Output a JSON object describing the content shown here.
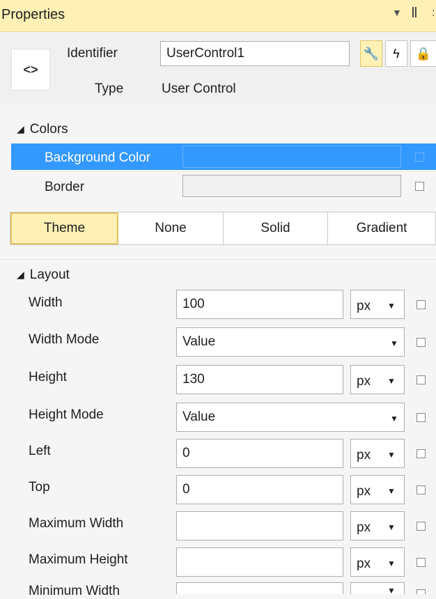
{
  "panel": {
    "title": "Properties",
    "dropdown_icon": "triangle-down-icon",
    "pin_icon": "pin-icon"
  },
  "header": {
    "code_button_glyph": "<>",
    "identifier_label": "Identifier",
    "identifier_value": "UserControl1",
    "type_label": "Type",
    "type_value": "User Control",
    "toolbar": [
      {
        "name": "properties-wrench-button",
        "glyph": "🔧",
        "icon": "wrench-icon",
        "active": true
      },
      {
        "name": "events-lightning-button",
        "glyph": "ϟ",
        "icon": "lightning-icon",
        "active": false
      },
      {
        "name": "lock-button",
        "glyph": "🔒",
        "icon": "lock-icon",
        "active": false
      }
    ]
  },
  "colors": {
    "section_label": "Colors",
    "background_color_label": "Background Color",
    "border_label": "Border",
    "tabs": [
      "Theme",
      "None",
      "Solid",
      "Gradient"
    ],
    "active_tab": "Theme",
    "selected_color": "#3399ff"
  },
  "layout": {
    "section_label": "Layout",
    "rows": [
      {
        "label": "Width",
        "value": "100",
        "unit": "px",
        "kind": "numeric"
      },
      {
        "label": "Width Mode",
        "value": "Value",
        "kind": "select"
      },
      {
        "label": "Height",
        "value": "130",
        "unit": "px",
        "kind": "numeric"
      },
      {
        "label": "Height Mode",
        "value": "Value",
        "kind": "select"
      },
      {
        "label": "Left",
        "value": "0",
        "unit": "px",
        "kind": "numeric"
      },
      {
        "label": "Top",
        "value": "0",
        "unit": "px",
        "kind": "numeric"
      },
      {
        "label": "Maximum Width",
        "value": "",
        "unit": "px",
        "kind": "numeric"
      },
      {
        "label": "Maximum Height",
        "value": "",
        "unit": "px",
        "kind": "numeric"
      },
      {
        "label": "Minimum Width",
        "value": "",
        "unit": "",
        "kind": "numeric"
      }
    ]
  },
  "theme": {
    "title_bar_bg": "#fff1b5",
    "accent": "#e5c365"
  }
}
